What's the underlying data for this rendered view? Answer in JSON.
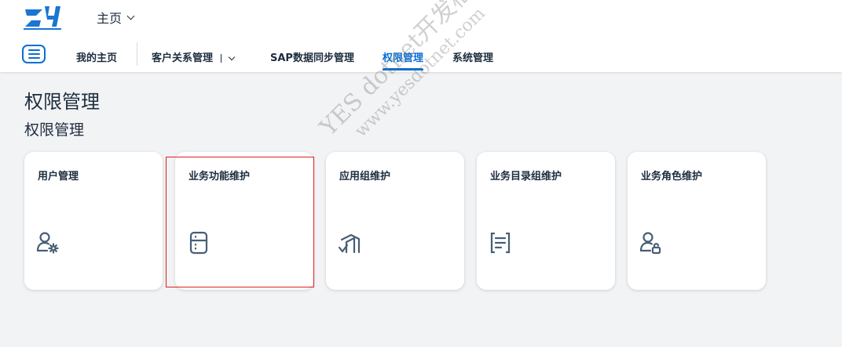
{
  "header": {
    "home_label": "主页"
  },
  "tabs": [
    {
      "label": "我的主页"
    },
    {
      "label": "客户关系管理"
    },
    {
      "label": "SAP数据同步管理"
    },
    {
      "label": "权限管理"
    },
    {
      "label": "系统管理"
    }
  ],
  "main": {
    "page_title": "权限管理",
    "section_title": "权限管理"
  },
  "tiles": [
    {
      "title": "用户管理",
      "icon": "user-settings-icon"
    },
    {
      "title": "业务功能维护",
      "icon": "building-icon"
    },
    {
      "title": "应用组维护",
      "icon": "app-group-icon"
    },
    {
      "title": "业务目录组维护",
      "icon": "document-list-icon"
    },
    {
      "title": "业务角色维护",
      "icon": "user-lock-icon"
    }
  ],
  "watermark": {
    "line1": "YES dotnet开发框架",
    "line2": "www.yesdotnet.com"
  },
  "colors": {
    "accent": "#0a6ed1",
    "highlight": "#e02020",
    "background": "#f2f3f5"
  }
}
